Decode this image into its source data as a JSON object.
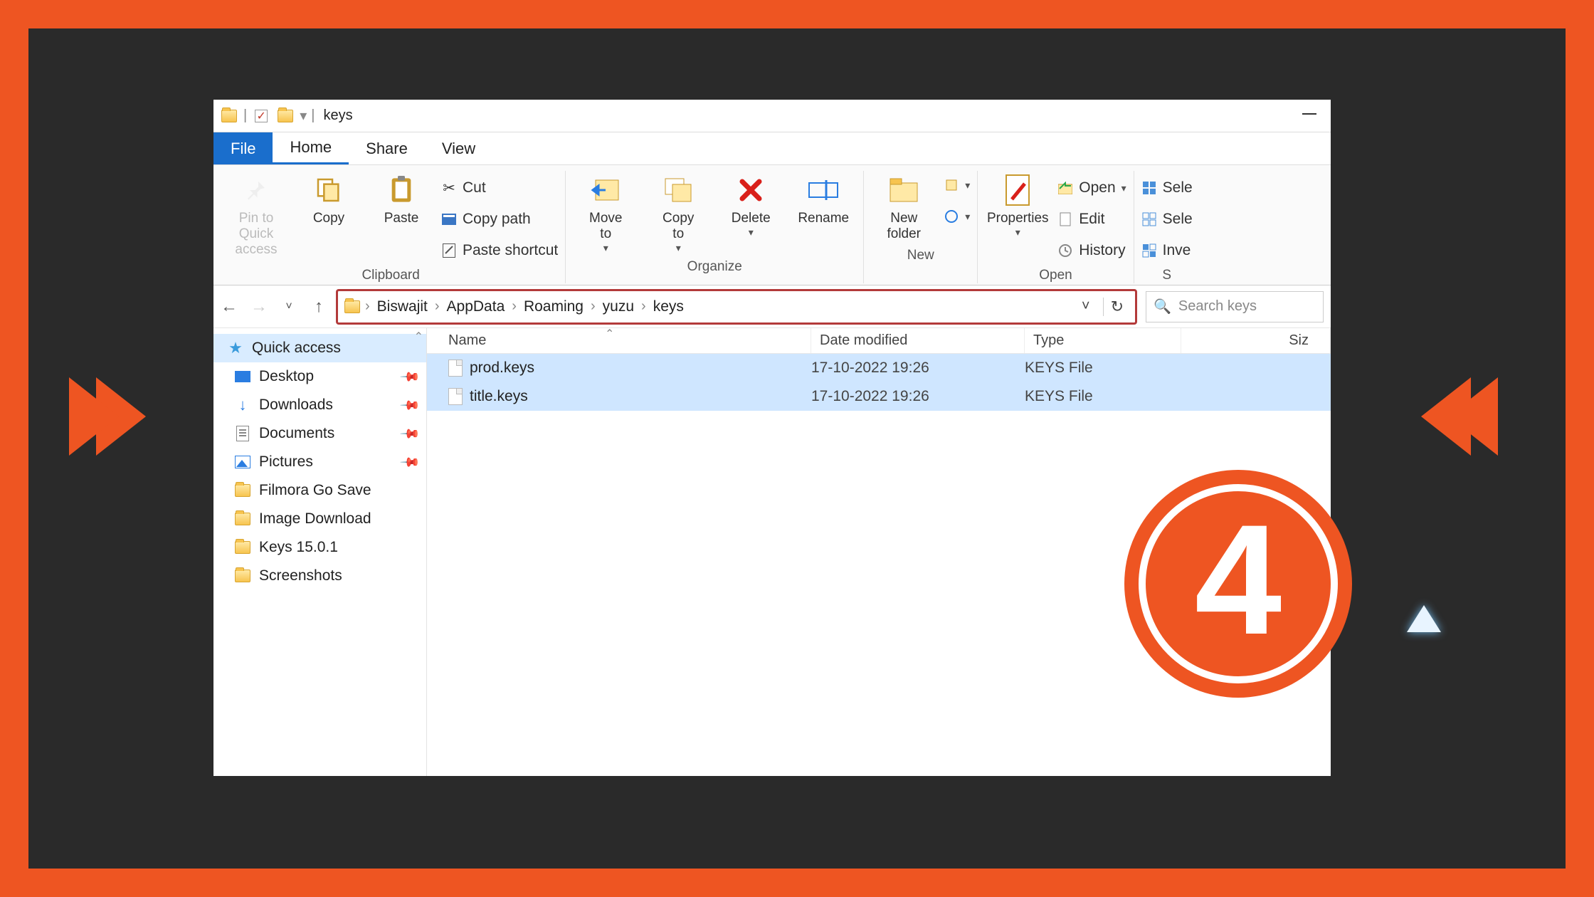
{
  "titlebar": {
    "title": "keys"
  },
  "tabs": {
    "file": "File",
    "home": "Home",
    "share": "Share",
    "view": "View"
  },
  "ribbon": {
    "pin": "Pin to Quick\naccess",
    "copy": "Copy",
    "paste": "Paste",
    "cut": "Cut",
    "copypath": "Copy path",
    "pasteshortcut": "Paste shortcut",
    "clipboard_group": "Clipboard",
    "moveto": "Move\nto",
    "copyto": "Copy\nto",
    "delete": "Delete",
    "rename": "Rename",
    "organize_group": "Organize",
    "newfolder": "New\nfolder",
    "new_group": "New",
    "properties": "Properties",
    "open": "Open",
    "edit": "Edit",
    "history": "History",
    "open_group": "Open",
    "select_all": "Sele",
    "select_none": "Sele",
    "invert": "Inve",
    "select_group": "S"
  },
  "breadcrumbs": [
    "Biswajit",
    "AppData",
    "Roaming",
    "yuzu",
    "keys"
  ],
  "search": {
    "placeholder": "Search keys"
  },
  "sidebar": {
    "header": "Quick access",
    "items": [
      {
        "label": "Desktop",
        "pinned": true
      },
      {
        "label": "Downloads",
        "pinned": true
      },
      {
        "label": "Documents",
        "pinned": true
      },
      {
        "label": "Pictures",
        "pinned": true
      },
      {
        "label": "Filmora Go Save",
        "pinned": false
      },
      {
        "label": "Image Download",
        "pinned": false
      },
      {
        "label": "Keys 15.0.1",
        "pinned": false
      },
      {
        "label": "Screenshots",
        "pinned": false
      }
    ]
  },
  "columns": {
    "name": "Name",
    "date": "Date modified",
    "type": "Type",
    "size": "Siz"
  },
  "files": [
    {
      "name": "prod.keys",
      "date": "17-10-2022 19:26",
      "type": "KEYS File"
    },
    {
      "name": "title.keys",
      "date": "17-10-2022 19:26",
      "type": "KEYS File"
    }
  ],
  "badge": {
    "number": "4"
  }
}
